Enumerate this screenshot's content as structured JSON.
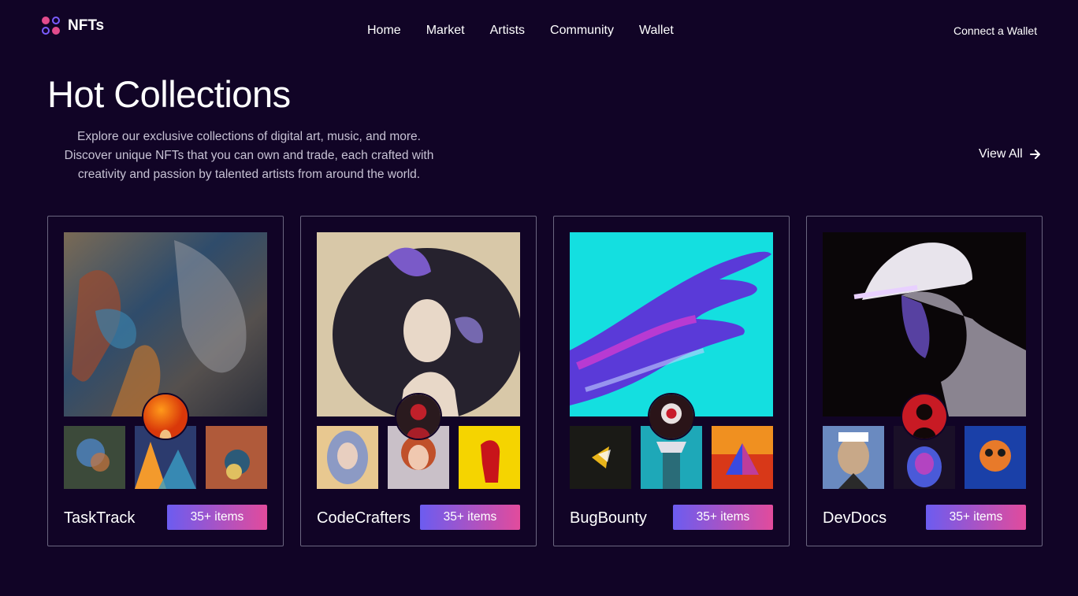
{
  "nav": {
    "brand": "NFTs",
    "items": [
      "Home",
      "Market",
      "Artists",
      "Community",
      "Wallet"
    ],
    "connect": "Connect a Wallet"
  },
  "hero": {
    "title": "Hot Collections",
    "description": "Explore our exclusive collections of digital art, music, and more. Discover unique NFTs that you can own and trade, each crafted with creativity and passion by talented artists from around the world.",
    "view_all": "View All"
  },
  "collections": [
    {
      "name": "TaskTrack",
      "count": "35+ items"
    },
    {
      "name": "CodeCrafters",
      "count": "35+ items"
    },
    {
      "name": "BugBounty",
      "count": "35+ items"
    },
    {
      "name": "DevDocs",
      "count": "35+ items"
    }
  ],
  "colors": {
    "background": "#110426",
    "accent_start": "#6c5cf0",
    "accent_end": "#e24b9c"
  },
  "icons": {
    "logo": "brand-logo-icon",
    "view_all": "arrow-right-icon"
  }
}
